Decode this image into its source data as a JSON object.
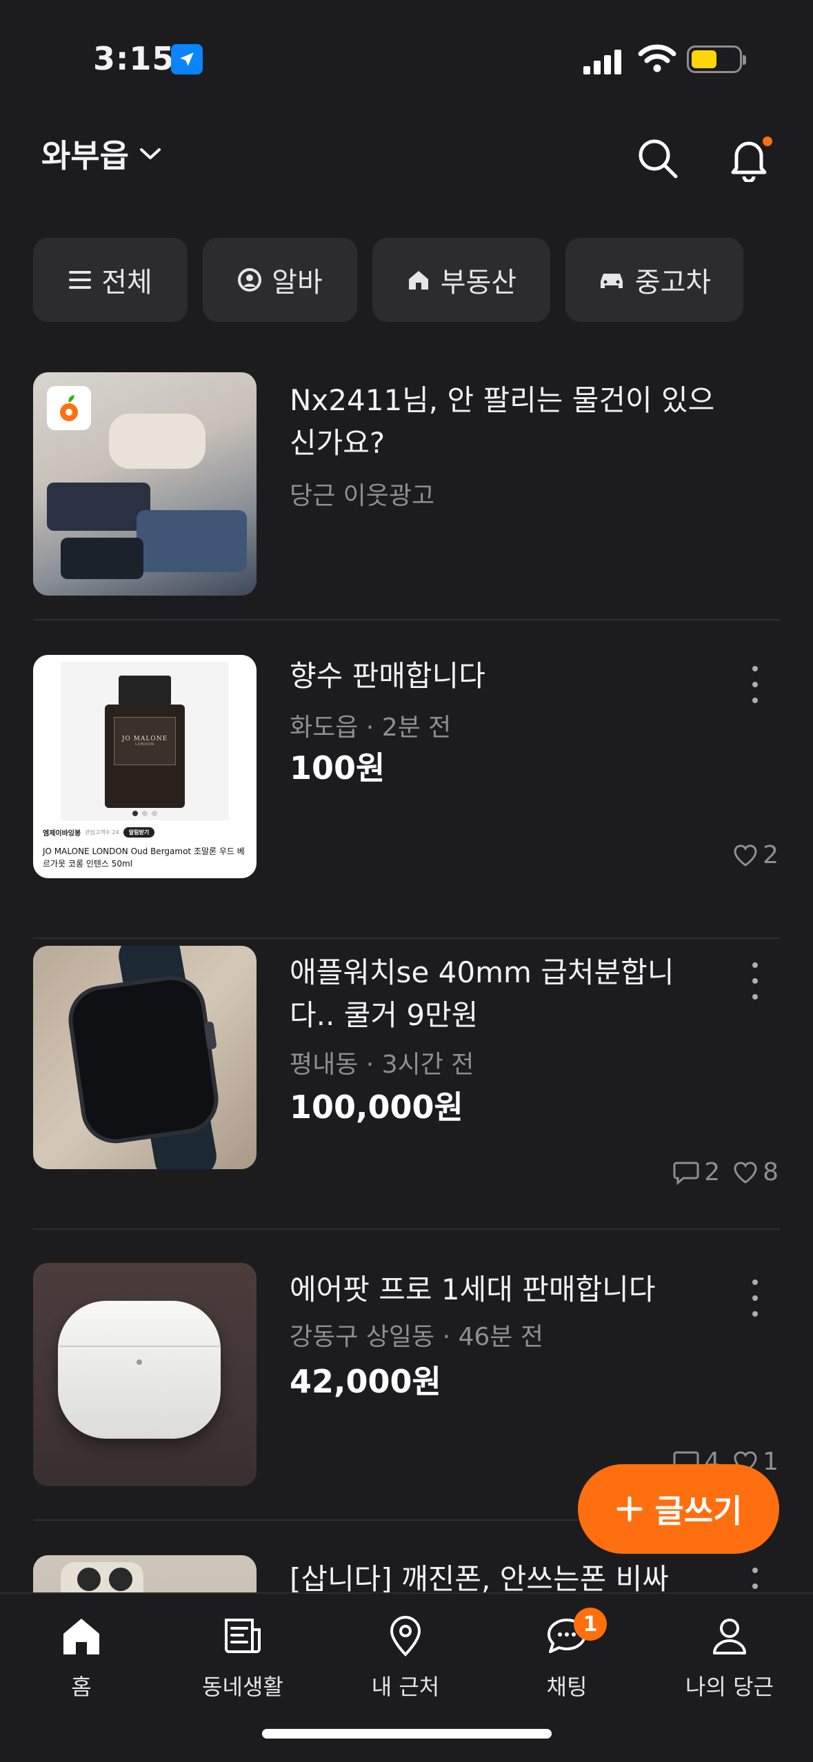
{
  "status": {
    "time": "3:15"
  },
  "header": {
    "location": "와부읍"
  },
  "chips": [
    {
      "label": "전체",
      "icon": "menu-icon"
    },
    {
      "label": "알바",
      "icon": "person-badge-icon"
    },
    {
      "label": "부동산",
      "icon": "house-icon"
    },
    {
      "label": "중고차",
      "icon": "car-icon"
    }
  ],
  "listings": [
    {
      "title": "Nx2411님, 안 팔리는 물건이 있으신가요?",
      "ad_label": "당근 이웃광고"
    },
    {
      "title": "향수 판매합니다",
      "meta": "화도읍 · 2분 전",
      "price": "100원",
      "likes": "2",
      "thumb_text": {
        "brand": "JO MALONE",
        "brand_sub": "LONDON",
        "tag": "알림받기",
        "seller": "엠제이바잉봉",
        "seller_sub": "관심고객수 24",
        "product": "JO MALONE LONDON Oud Bergamot 조말론 우드 베르가못 코롱 인텐스 50ml"
      }
    },
    {
      "title": "애플워치se 40mm 급처분합니다.. 쿨거 9만원",
      "meta": "평내동 · 3시간 전",
      "price": "100,000원",
      "chats": "2",
      "likes": "8"
    },
    {
      "title": "에어팟 프로 1세대 판매합니다",
      "meta": "강동구 상일동 · 46분 전",
      "price": "42,000원",
      "chats": "4",
      "likes": "1"
    },
    {
      "title": "[삽니다] 깨진폰, 안쓰는폰 비싸"
    }
  ],
  "fab": {
    "label": "글쓰기",
    "icon": "plus-icon"
  },
  "tabs": [
    {
      "label": "홈",
      "icon": "home-icon"
    },
    {
      "label": "동네생활",
      "icon": "newspaper-icon"
    },
    {
      "label": "내 근처",
      "icon": "location-pin-icon"
    },
    {
      "label": "채팅",
      "icon": "chat-icon",
      "badge": "1"
    },
    {
      "label": "나의 당근",
      "icon": "profile-icon"
    }
  ],
  "colors": {
    "accent": "#ff6f0f",
    "background": "#1c1c1e",
    "chip": "#2c2c2e"
  }
}
